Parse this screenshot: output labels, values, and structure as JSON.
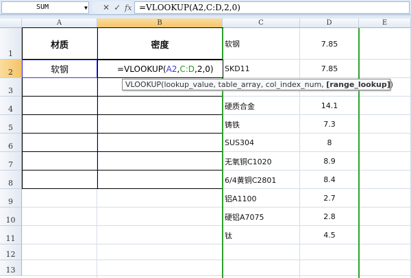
{
  "formula_bar": {
    "name_box": "SUM",
    "formula": "=VLOOKUP(A2,C:D,2,0)",
    "cancel_icon": "✕",
    "enter_icon": "✓",
    "fx_label": "fx"
  },
  "columns": [
    "A",
    "B",
    "C",
    "D",
    "E"
  ],
  "rows": [
    "1",
    "2",
    "3",
    "4",
    "5",
    "6",
    "7",
    "8",
    "9",
    "10",
    "11",
    "12",
    "13"
  ],
  "cells": {
    "A1": "材质",
    "B1": "密度",
    "A2": "软钢"
  },
  "edit": {
    "prefix": "=VLOOKUP(",
    "ref1": "A2",
    "sep1": ",",
    "ref2": "C:D",
    "rest": ",2,0)",
    "ref1_color": "#3a3adb",
    "ref2_color": "#1f9a1f"
  },
  "tooltip": {
    "text": "VLOOKUP(lookup_value, table_array, col_index_num, ",
    "bold": "[range_lookup]",
    "end": ")"
  },
  "lookup": [
    {
      "row": 1,
      "c": "软钢",
      "d": "7.85"
    },
    {
      "row": 2,
      "c": "SKD11",
      "d": "7.85"
    },
    {
      "row": 4,
      "c": "硬质合金",
      "d": "14.1"
    },
    {
      "row": 5,
      "c": "铸铁",
      "d": "7.3"
    },
    {
      "row": 6,
      "c": "SUS304",
      "d": "8"
    },
    {
      "row": 7,
      "c": "无氧铜C1020",
      "d": "8.9"
    },
    {
      "row": 8,
      "c": "6/4黄铜C2801",
      "d": "8.4"
    },
    {
      "row": 9,
      "c": "铝A1100",
      "d": "2.7"
    },
    {
      "row": 10,
      "c": "硬铝A7075",
      "d": "2.8"
    },
    {
      "row": 11,
      "c": "钛",
      "d": "4.5"
    }
  ]
}
